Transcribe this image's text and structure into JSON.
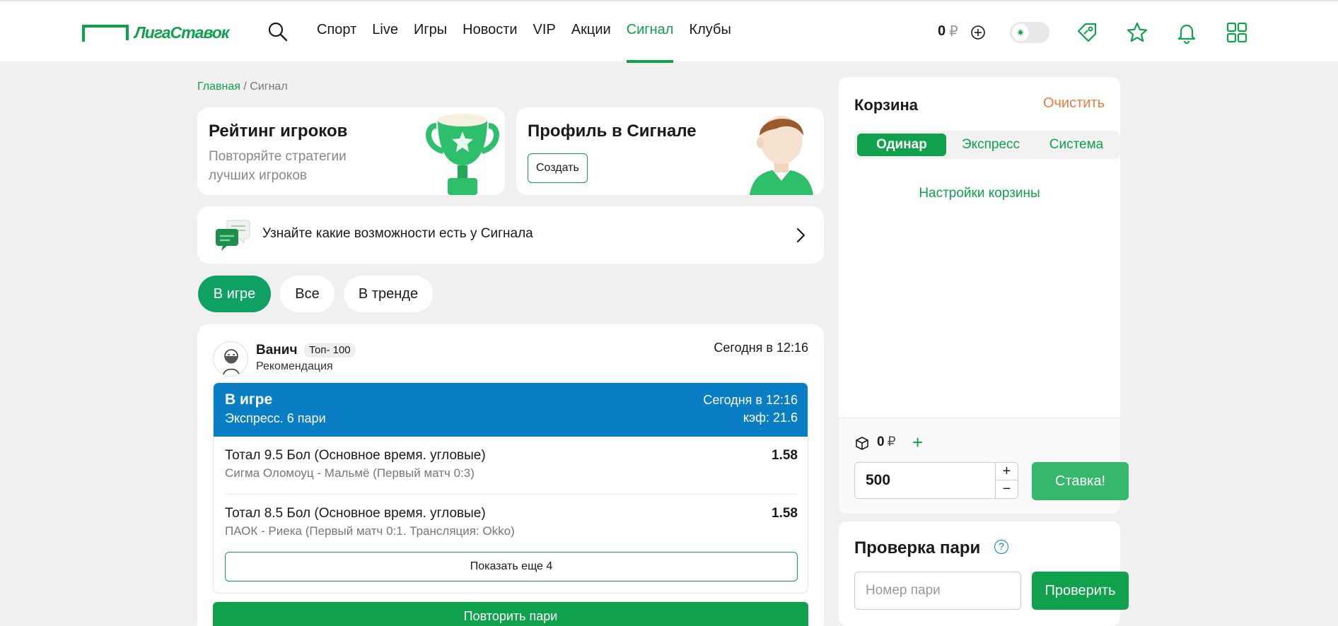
{
  "header": {
    "logo_text": "ЛигаСтавок",
    "nav": [
      "Спорт",
      "Live",
      "Игры",
      "Новости",
      "VIP",
      "Акции",
      "Сигнал",
      "Клубы"
    ],
    "active_nav": "Сигнал",
    "balance": "0",
    "currency": "₽"
  },
  "breadcrumb": {
    "home": "Главная",
    "sep": " / ",
    "current": "Сигнал"
  },
  "promo": {
    "rating": {
      "title": "Рейтинг игроков",
      "subtitle": "Повторяйте стратегии лучших игроков"
    },
    "profile": {
      "title": "Профиль в Сигнале",
      "button": "Создать"
    }
  },
  "info_banner": {
    "text": "Узнайте какие возможности есть у Сигнала"
  },
  "filters": [
    {
      "label": "В игре",
      "active": true
    },
    {
      "label": "Все",
      "active": false
    },
    {
      "label": "В тренде",
      "active": false
    }
  ],
  "signal": {
    "author": "Ванич",
    "badge": "Топ- 100",
    "role": "Рекомендация",
    "time": "Сегодня в 12:16",
    "bet": {
      "status": "В игре",
      "type": "Экспресс. 6 пари",
      "time": "Сегодня в 12:16",
      "coef": "кэф: 21.6",
      "events": [
        {
          "title": "Тотал 9.5 Бол (Основное время. угловые)",
          "match": "Сигма Оломоуц - Мальмё (Первый матч 0:3)",
          "odd": "1.58"
        },
        {
          "title": "Тотал 8.5 Бол (Основное время. угловые)",
          "match": "ПАОК - Риека (Первый матч 0:1. Трансляция: Okko)",
          "odd": "1.58"
        }
      ],
      "show_more": "Показать еще 4"
    },
    "repeat": "Повторить пари"
  },
  "basket": {
    "title": "Корзина",
    "clear": "Очистить",
    "tabs": [
      "Одинар",
      "Экспресс",
      "Система"
    ],
    "active_tab": "Одинар",
    "settings": "Настройки корзины",
    "freebet": "0",
    "currency": "₽",
    "stake": "500",
    "stake_button": "Ставка!"
  },
  "check": {
    "title": "Проверка пари",
    "help": "?",
    "placeholder": "Номер пари",
    "button": "Проверить"
  },
  "colors": {
    "brand": "#0fa14b",
    "accent_blue": "#0a7ec4",
    "clear": "#f07b3a"
  }
}
